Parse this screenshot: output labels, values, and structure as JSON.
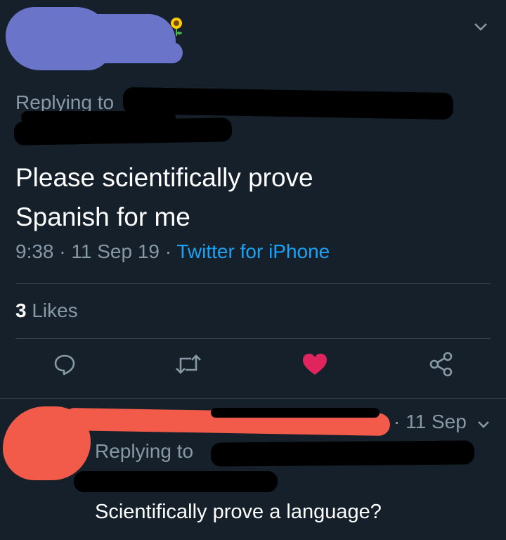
{
  "tweet": {
    "replying_to_label": "Replying to",
    "text_line1": "Please scientifically prove",
    "text_line2": "Spanish for me",
    "time": "9:38",
    "sep1": "·",
    "date": "11 Sep 19",
    "sep2": "·",
    "source": "Twitter for iPhone",
    "likes_count": "3",
    "likes_label": "Likes"
  },
  "reply": {
    "time_sep": "·",
    "time": "11 Sep",
    "replying_to_label": "Replying to",
    "text": "Scientifically prove a language?"
  },
  "colors": {
    "background": "#15202b",
    "secondary_text": "#8899a6",
    "link": "#1da1f2",
    "like_active": "#e0245e",
    "divider": "#38444d",
    "redaction_blue": "#6a74c9",
    "redaction_red": "#f25b4a"
  },
  "icons": {
    "chevron": "chevron-down-icon",
    "reply": "reply-icon",
    "retweet": "retweet-icon",
    "like": "heart-icon",
    "share": "share-icon",
    "sunflower": "sunflower-icon"
  }
}
